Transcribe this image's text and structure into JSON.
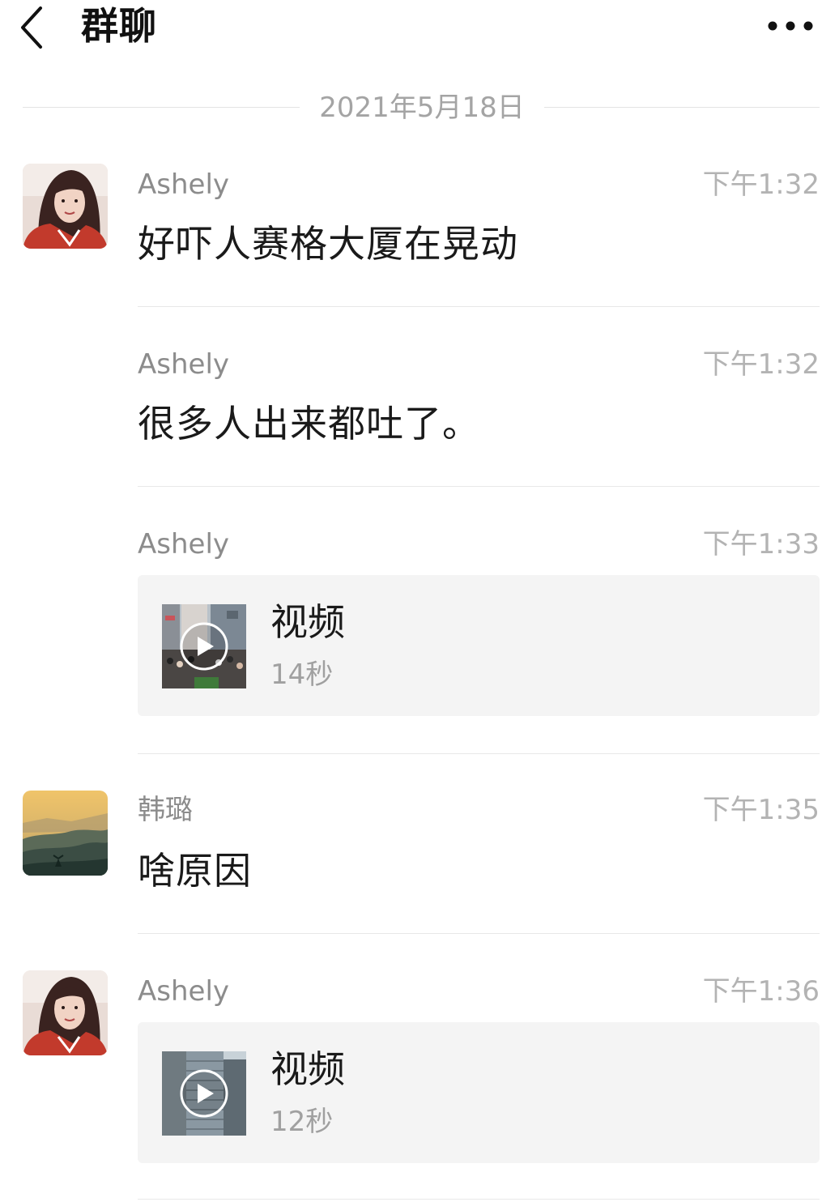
{
  "header": {
    "title": "群聊",
    "back_icon": "chevron-left-icon",
    "more_icon": "more-dots-icon"
  },
  "date_divider": "2021年5月18日",
  "messages": [
    {
      "sender": "Ashely",
      "time": "下午1:32",
      "type": "text",
      "text": "好吓人赛格大厦在晃动",
      "avatar": "woman-portrait"
    },
    {
      "sender": "Ashely",
      "time": "下午1:32",
      "type": "text",
      "text": "很多人出来都吐了。"
    },
    {
      "sender": "Ashely",
      "time": "下午1:33",
      "type": "video",
      "label": "视频",
      "duration": "14秒"
    },
    {
      "sender": "韩璐",
      "time": "下午1:35",
      "type": "text",
      "text": "啥原因",
      "avatar": "mountain-landscape"
    },
    {
      "sender": "Ashely",
      "time": "下午1:36",
      "type": "video",
      "label": "视频",
      "duration": "12秒",
      "avatar": "woman-portrait"
    }
  ],
  "colors": {
    "background": "#ffffff",
    "card": "#f4f4f4",
    "divider": "#e8e8e8",
    "meta_text": "#a4a4a4"
  }
}
